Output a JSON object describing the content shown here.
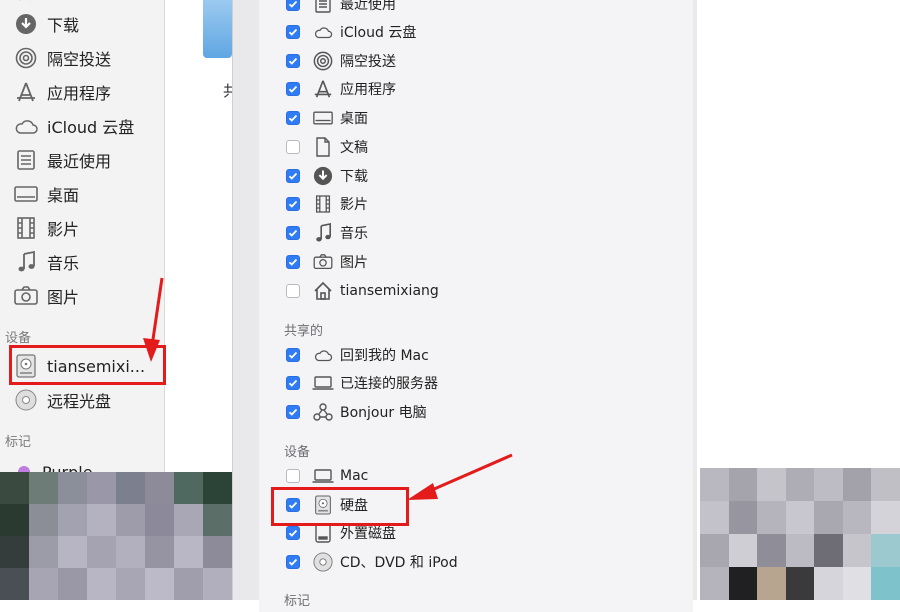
{
  "sidebar": {
    "top_partial_label": "下载",
    "items": [
      {
        "label": "下载",
        "icon": "download-icon"
      },
      {
        "label": "隔空投送",
        "icon": "airdrop-icon"
      },
      {
        "label": "应用程序",
        "icon": "applications-icon"
      },
      {
        "label": "iCloud 云盘",
        "icon": "cloud-icon"
      },
      {
        "label": "最近使用",
        "icon": "recents-icon"
      },
      {
        "label": "桌面",
        "icon": "desktop-icon"
      },
      {
        "label": "影片",
        "icon": "movies-icon"
      },
      {
        "label": "音乐",
        "icon": "music-icon"
      },
      {
        "label": "图片",
        "icon": "pictures-icon"
      }
    ],
    "devices_header": "设备",
    "devices": [
      {
        "label": "tiansemixi...",
        "icon": "hard-disk-icon"
      },
      {
        "label": "远程光盘",
        "icon": "remote-disc-icon"
      }
    ],
    "tags_header": "标记",
    "tags": [
      {
        "label": "Purple",
        "color": "#c17ce0"
      }
    ]
  },
  "behind_window": {
    "partial_char": "共"
  },
  "sheet": {
    "favorites": [
      {
        "label": "最近使用",
        "checked": true,
        "icon": "recents-icon"
      },
      {
        "label": "iCloud 云盘",
        "checked": true,
        "icon": "cloud-icon"
      },
      {
        "label": "隔空投送",
        "checked": true,
        "icon": "airdrop-icon"
      },
      {
        "label": "应用程序",
        "checked": true,
        "icon": "applications-icon"
      },
      {
        "label": "桌面",
        "checked": true,
        "icon": "desktop-icon"
      },
      {
        "label": "文稿",
        "checked": false,
        "icon": "document-icon"
      },
      {
        "label": "下载",
        "checked": true,
        "icon": "download-icon"
      },
      {
        "label": "影片",
        "checked": true,
        "icon": "movies-icon"
      },
      {
        "label": "音乐",
        "checked": true,
        "icon": "music-icon"
      },
      {
        "label": "图片",
        "checked": true,
        "icon": "pictures-icon"
      },
      {
        "label": "tiansemixiang",
        "checked": false,
        "icon": "home-icon"
      }
    ],
    "shared_header": "共享的",
    "shared": [
      {
        "label": "回到我的 Mac",
        "checked": true,
        "icon": "cloud-icon"
      },
      {
        "label": "已连接的服务器",
        "checked": true,
        "icon": "laptop-icon"
      },
      {
        "label": "Bonjour 电脑",
        "checked": true,
        "icon": "bonjour-icon"
      }
    ],
    "devices_header": "设备",
    "devices": [
      {
        "label": "Mac",
        "checked": false,
        "icon": "laptop-icon"
      },
      {
        "label": "硬盘",
        "checked": true,
        "icon": "hard-disk-icon"
      },
      {
        "label": "外置磁盘",
        "checked": true,
        "icon": "external-disk-icon"
      },
      {
        "label": "CD、DVD 和 iPod",
        "checked": true,
        "icon": "cd-icon"
      }
    ],
    "tags_header": "标记"
  },
  "colors": {
    "accent": "#2f7cf6",
    "annotation": "#e31b1b"
  }
}
